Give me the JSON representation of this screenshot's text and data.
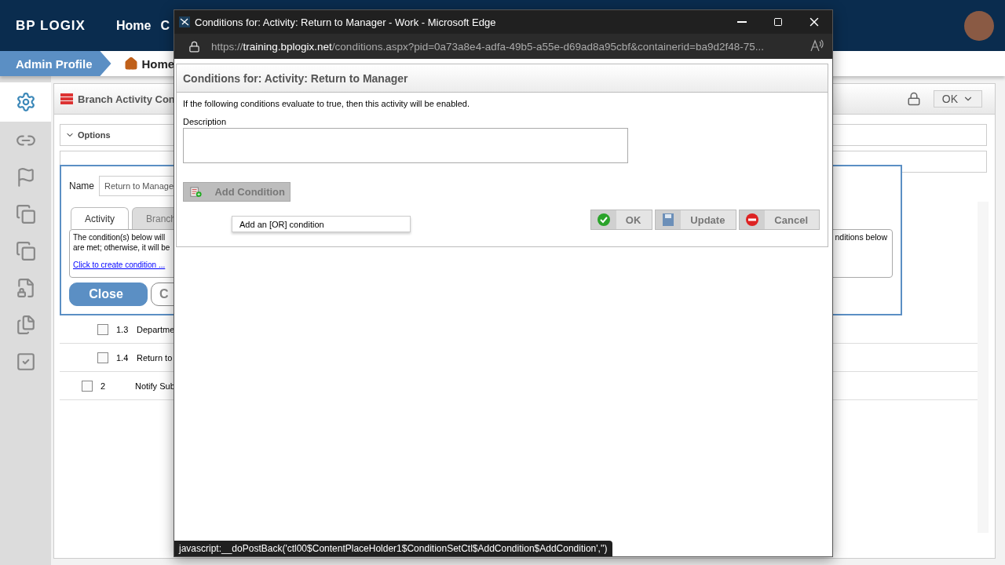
{
  "topbar": {
    "logo": "BP LOGIX",
    "nav": [
      {
        "label": "Home"
      },
      {
        "label": "C"
      }
    ]
  },
  "breadcrumb": [
    {
      "label": "Admin Profile",
      "kind": "profile"
    },
    {
      "label": "Home",
      "kind": "home"
    }
  ],
  "sidebar": [
    {
      "selected": true
    },
    {
      "selected": false
    },
    {
      "selected": false
    },
    {
      "selected": false
    },
    {
      "selected": false
    },
    {
      "selected": false
    },
    {
      "selected": false
    },
    {
      "selected": false
    }
  ],
  "panel": {
    "title": "Branch Activity Con",
    "ok_button": "OK",
    "options_label": "Options"
  },
  "editor": {
    "name_label": "Name",
    "name_value": "Return to Manage",
    "tabs": [
      {
        "label": "Activity",
        "selected": true
      },
      {
        "label": "Branch",
        "selected": false
      }
    ],
    "condition_lines": [
      "The condition(s) below will",
      "are met; otherwise, it will be"
    ],
    "condition_right": "nditions below",
    "link": "Click to create condition ...",
    "buttons": [
      {
        "label": "Close",
        "kind": "primary"
      },
      {
        "label": "C",
        "kind": "secondary"
      }
    ]
  },
  "rows": [
    {
      "children": [
        {
          "number": "1.3",
          "name": "Departme",
          "checked": false
        },
        {
          "number": "1.4",
          "name": "Return to",
          "checked": false
        }
      ]
    },
    {
      "number": "2",
      "name": "Notify Sub",
      "checked": false
    }
  ],
  "popup": {
    "title": "Conditions for: Activity: Return to Manager - Work - Microsoft Edge",
    "url_scheme": "https://",
    "url_host": "training.bplogix.net",
    "url_rest": "/conditions.aspx?pid=0a73a8e4-adfa-49b5-a55e-d69ad8a95cbf&containerid=ba9d2f48-75...",
    "heading": "Conditions for: Activity: Return to Manager",
    "intro": "If the following conditions evaluate to true, then this activity will be enabled.",
    "description_label": "Description",
    "add_button": "Add Condition",
    "tooltip": "Add an [OR] condition",
    "buttons": [
      {
        "label": "OK",
        "kind": "ok"
      },
      {
        "label": "Update",
        "kind": "update"
      },
      {
        "label": "Cancel",
        "kind": "cancel"
      }
    ],
    "status": "javascript:__doPostBack('ctl00$ContentPlaceHolder1$ConditionSetCtl$AddCondition$AddCondition','')"
  }
}
